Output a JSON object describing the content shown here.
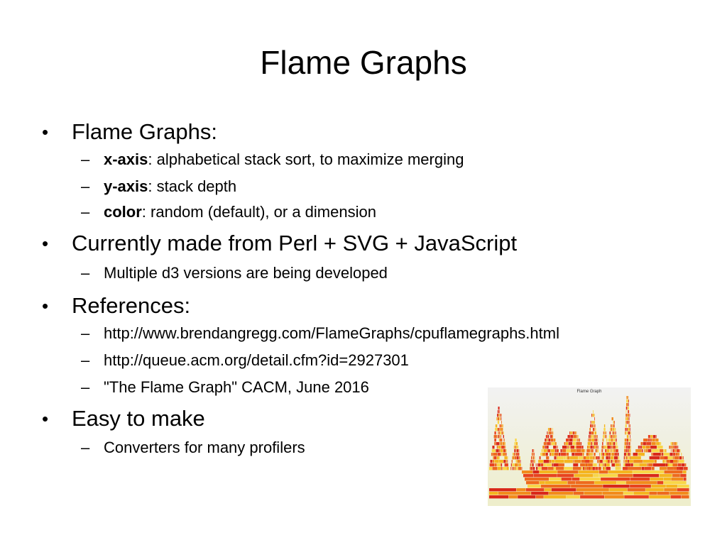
{
  "slide": {
    "title": "Flame Graphs",
    "bullets": [
      {
        "text": "Flame Graphs:",
        "subs": [
          {
            "bold": "x-axis",
            "rest": ": alphabetical stack sort, to maximize merging"
          },
          {
            "bold": "y-axis",
            "rest": ": stack depth"
          },
          {
            "bold": "color",
            "rest": ": random (default), or a dimension"
          }
        ]
      },
      {
        "text": "Currently made from Perl + SVG + JavaScript",
        "subs": [
          {
            "text": "Multiple d3 versions are being developed"
          }
        ]
      },
      {
        "text": "References:",
        "subs": [
          {
            "text": "http://www.brendangregg.com/FlameGraphs/cpuflamegraphs.html"
          },
          {
            "text": "http://queue.acm.org/detail.cfm?id=2927301"
          },
          {
            "text": "\"The Flame Graph\" CACM, June 2016"
          }
        ]
      },
      {
        "text": "Easy to make",
        "subs": [
          {
            "text": "Converters for many profilers"
          }
        ]
      }
    ],
    "bullet_glyph": "•",
    "dash_glyph": "–"
  },
  "thumbnail": {
    "title": "Flame Graph",
    "colors": [
      "#e8431f",
      "#f28b1c",
      "#f5b51f",
      "#d9281a",
      "#f9d648",
      "#ee6a1d"
    ]
  }
}
